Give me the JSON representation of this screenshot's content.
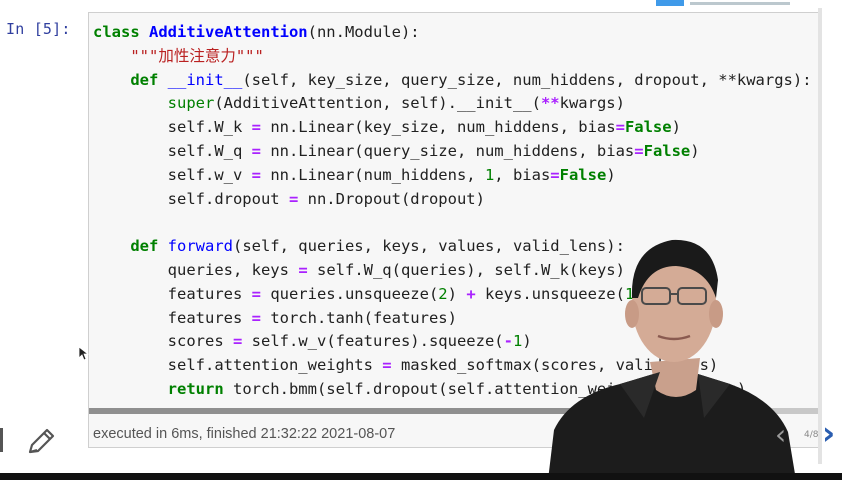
{
  "cell": {
    "prompt": "In [5]:",
    "code_lines": [
      [
        {
          "t": "class ",
          "c": "kw"
        },
        {
          "t": "AdditiveAttention",
          "c": "cls"
        },
        {
          "t": "(nn.Module):",
          "c": ""
        }
      ],
      [
        {
          "t": "    ",
          "c": ""
        },
        {
          "t": "\"\"\"加性注意力\"\"\"",
          "c": "str"
        }
      ],
      [
        {
          "t": "    ",
          "c": ""
        },
        {
          "t": "def ",
          "c": "kw"
        },
        {
          "t": "__init__",
          "c": "fn"
        },
        {
          "t": "(self, key_size, query_size, num_hiddens, dropout, **kwargs):",
          "c": ""
        }
      ],
      [
        {
          "t": "        ",
          "c": ""
        },
        {
          "t": "super",
          "c": "bi"
        },
        {
          "t": "(AdditiveAttention, self).__init__(",
          "c": ""
        },
        {
          "t": "**",
          "c": "op"
        },
        {
          "t": "kwargs)",
          "c": ""
        }
      ],
      [
        {
          "t": "        self.W_k ",
          "c": ""
        },
        {
          "t": "=",
          "c": "op"
        },
        {
          "t": " nn.Linear(key_size, num_hiddens, bias",
          "c": ""
        },
        {
          "t": "=",
          "c": "op"
        },
        {
          "t": "False",
          "c": "cst"
        },
        {
          "t": ")",
          "c": ""
        }
      ],
      [
        {
          "t": "        self.W_q ",
          "c": ""
        },
        {
          "t": "=",
          "c": "op"
        },
        {
          "t": " nn.Linear(query_size, num_hiddens, bias",
          "c": ""
        },
        {
          "t": "=",
          "c": "op"
        },
        {
          "t": "False",
          "c": "cst"
        },
        {
          "t": ")",
          "c": ""
        }
      ],
      [
        {
          "t": "        self.w_v ",
          "c": ""
        },
        {
          "t": "=",
          "c": "op"
        },
        {
          "t": " nn.Linear(num_hiddens, ",
          "c": ""
        },
        {
          "t": "1",
          "c": "num"
        },
        {
          "t": ", bias",
          "c": ""
        },
        {
          "t": "=",
          "c": "op"
        },
        {
          "t": "False",
          "c": "cst"
        },
        {
          "t": ")",
          "c": ""
        }
      ],
      [
        {
          "t": "        self.dropout ",
          "c": ""
        },
        {
          "t": "=",
          "c": "op"
        },
        {
          "t": " nn.Dropout(dropout)",
          "c": ""
        }
      ],
      [
        {
          "t": "",
          "c": ""
        }
      ],
      [
        {
          "t": "    ",
          "c": ""
        },
        {
          "t": "def ",
          "c": "kw"
        },
        {
          "t": "forward",
          "c": "fn"
        },
        {
          "t": "(self, queries, keys, values, valid_lens):",
          "c": ""
        }
      ],
      [
        {
          "t": "        queries, keys ",
          "c": ""
        },
        {
          "t": "=",
          "c": "op"
        },
        {
          "t": " self.W_q(queries), self.W_k(keys)",
          "c": ""
        }
      ],
      [
        {
          "t": "        features ",
          "c": ""
        },
        {
          "t": "=",
          "c": "op"
        },
        {
          "t": " queries.unsqueeze(",
          "c": ""
        },
        {
          "t": "2",
          "c": "num"
        },
        {
          "t": ") ",
          "c": ""
        },
        {
          "t": "+",
          "c": "op"
        },
        {
          "t": " keys.unsqueeze(",
          "c": ""
        },
        {
          "t": "1",
          "c": "num"
        },
        {
          "t": ")",
          "c": ""
        }
      ],
      [
        {
          "t": "        features ",
          "c": ""
        },
        {
          "t": "=",
          "c": "op"
        },
        {
          "t": " torch.tanh(features)",
          "c": ""
        }
      ],
      [
        {
          "t": "        scores ",
          "c": ""
        },
        {
          "t": "=",
          "c": "op"
        },
        {
          "t": " self.w_v(features).squeeze(",
          "c": ""
        },
        {
          "t": "-",
          "c": "op"
        },
        {
          "t": "1",
          "c": "num"
        },
        {
          "t": ")",
          "c": ""
        }
      ],
      [
        {
          "t": "        self.attention_weights ",
          "c": ""
        },
        {
          "t": "=",
          "c": "op"
        },
        {
          "t": " masked_softmax(scores, valid_lens)",
          "c": ""
        }
      ],
      [
        {
          "t": "        ",
          "c": ""
        },
        {
          "t": "return ",
          "c": "kw"
        },
        {
          "t": "torch.bmm(self.dropout(self.attention_weights), values)",
          "c": ""
        }
      ]
    ],
    "exec_info": "executed in 6ms, finished 21:32:22 2021-08-07"
  },
  "nav": {
    "prev_icon": "chevron-left-icon",
    "next_icon": "chevron-right-icon",
    "prev_glyph": "‹",
    "next_glyph": "›",
    "page": "4/8"
  },
  "colors": {
    "prompt": "#303f9f",
    "keyword": "#008000",
    "string": "#ba2121",
    "operator": "#aa22ff",
    "nav_next": "#2a5db0"
  }
}
